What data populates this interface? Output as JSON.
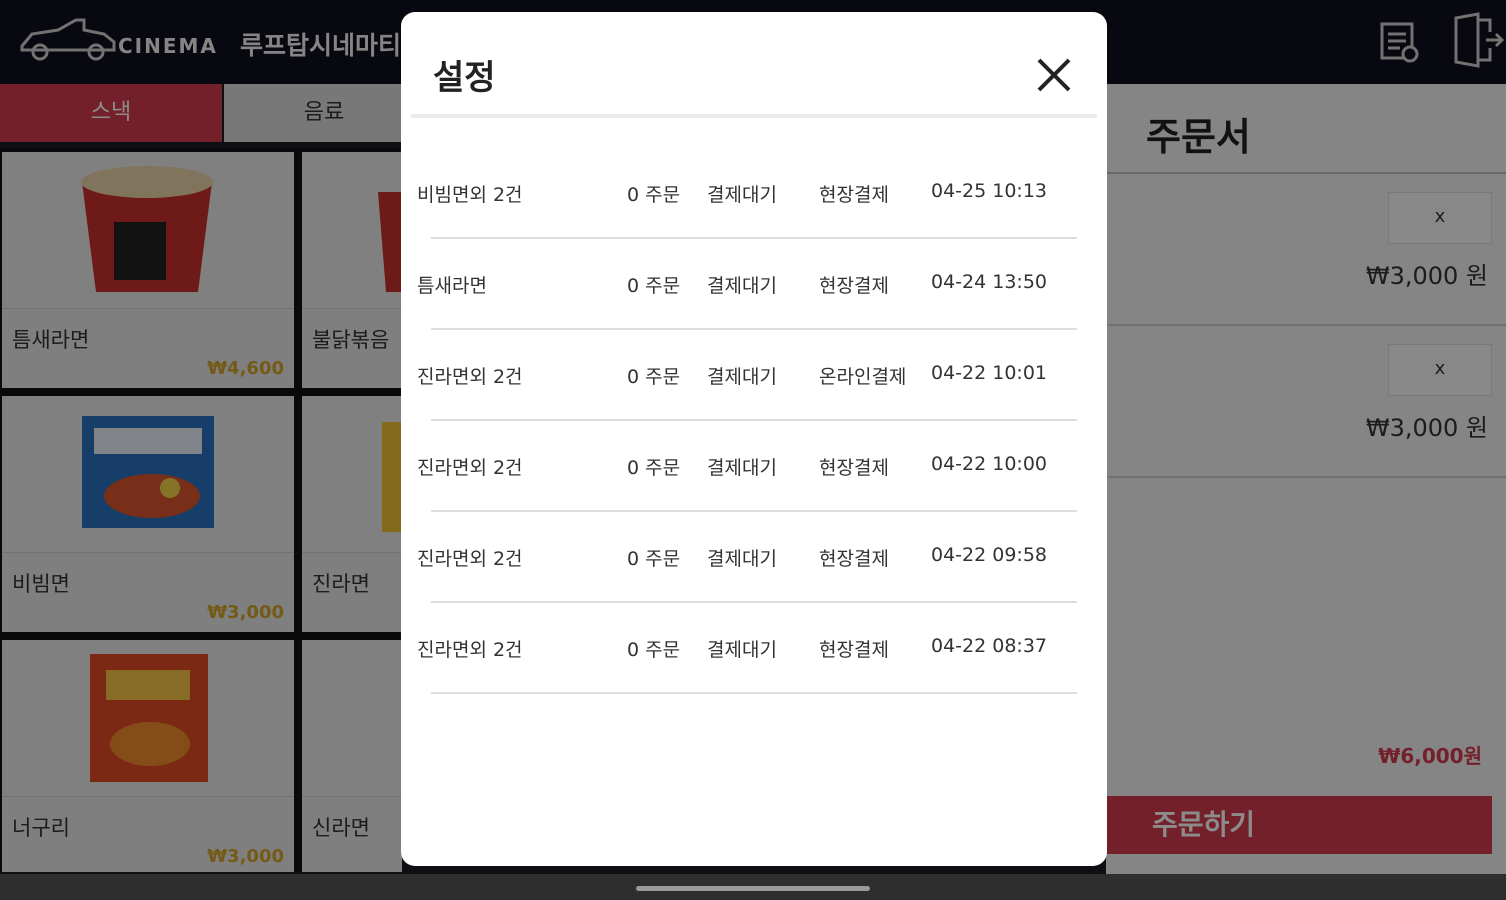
{
  "header": {
    "logo_text": "CINEMA",
    "store_name": "루프탑시네마티"
  },
  "tabs": [
    {
      "label": "스낵",
      "active": true
    },
    {
      "label": "음료",
      "active": false
    }
  ],
  "menu_items": [
    {
      "name": "틈새라면",
      "price": "₩4,600"
    },
    {
      "name": "불닭볶음",
      "price": ""
    },
    {
      "name": "비빔면",
      "price": "₩3,000"
    },
    {
      "name": "진라면",
      "price": ""
    },
    {
      "name": "너구리",
      "price": "₩3,000"
    },
    {
      "name": "신라면",
      "price": ""
    }
  ],
  "order": {
    "title": "주문서",
    "items": [
      {
        "remove_label": "x",
        "price": "₩3,000 원"
      },
      {
        "remove_label": "x",
        "price": "₩3,000 원"
      }
    ],
    "total": "₩6,000원",
    "submit_label": "주문하기"
  },
  "modal": {
    "title": "설정",
    "rows": [
      {
        "name": "비빔면외 2건",
        "count": "0 주문",
        "status": "결제대기",
        "method": "현장결제",
        "time": "04-25 10:13"
      },
      {
        "name": "틈새라면",
        "count": "0 주문",
        "status": "결제대기",
        "method": "현장결제",
        "time": "04-24 13:50"
      },
      {
        "name": "진라면외 2건",
        "count": "0 주문",
        "status": "결제대기",
        "method": "온라인결제",
        "time": "04-22 10:01"
      },
      {
        "name": "진라면외 2건",
        "count": "0 주문",
        "status": "결제대기",
        "method": "현장결제",
        "time": "04-22 10:00"
      },
      {
        "name": "진라면외 2건",
        "count": "0 주문",
        "status": "결제대기",
        "method": "현장결제",
        "time": "04-22 09:58"
      },
      {
        "name": "진라면외 2건",
        "count": "0 주문",
        "status": "결제대기",
        "method": "현장결제",
        "time": "04-22 08:37"
      }
    ]
  },
  "colors": {
    "accent": "#d43b4e",
    "topbar": "#0f0f1e",
    "price_gold": "#d4a52a"
  },
  "icons": [
    "car-logo-icon",
    "receipt-icon",
    "exit-door-icon",
    "close-icon"
  ]
}
